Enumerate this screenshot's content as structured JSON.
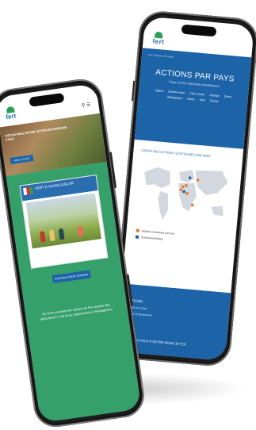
{
  "back_phone": {
    "brand": "fert",
    "breadcrumb": "Fert / Actions / Par pays",
    "hero_title": "ACTIONS PAR PAYS",
    "hero_subtitle": "Pays où Fert intervient actuellement",
    "countries": [
      "Algérie",
      "Burkina Faso",
      "Côte d'Ivoire",
      "Géorgie",
      "Grèce",
      "Madagascar",
      "Maroc",
      "Mali",
      "Tunisie"
    ],
    "map_title": "CARTE DES ACTIONS SOUTENUES PAR FERT",
    "legend": [
      {
        "label": "Actions soutenues par Fert",
        "color": "#e07a2e"
      },
      {
        "label": "Actions terminées",
        "color": "#1c63a8"
      }
    ],
    "actions_heading": "ACTIONS",
    "actions_items": [
      "Actions par pays",
      "Paroles d'agriculteurs"
    ],
    "newsletter": "ABONNEZ-VOUS À NOTRE NEWSLETTER"
  },
  "front_phone": {
    "brand": "fert",
    "icons": [
      "search-icon",
      "menu-icon"
    ],
    "banner_text": "DÉCOUVREZ NOTRE ACTION EN BURKINA FASO",
    "banner_button": "LIRE LA SUITE",
    "card_title": "FERT À MADAGASCAR",
    "discover_button": "Consulter la fiche Fert/pays",
    "body_text": "Ce texte présente les actions de Fert auprès des agriculteurs et de leurs organisations à Madagascar."
  },
  "colors": {
    "blue": "#1c63a8",
    "green": "#35a06a",
    "orange": "#e07a2e"
  }
}
